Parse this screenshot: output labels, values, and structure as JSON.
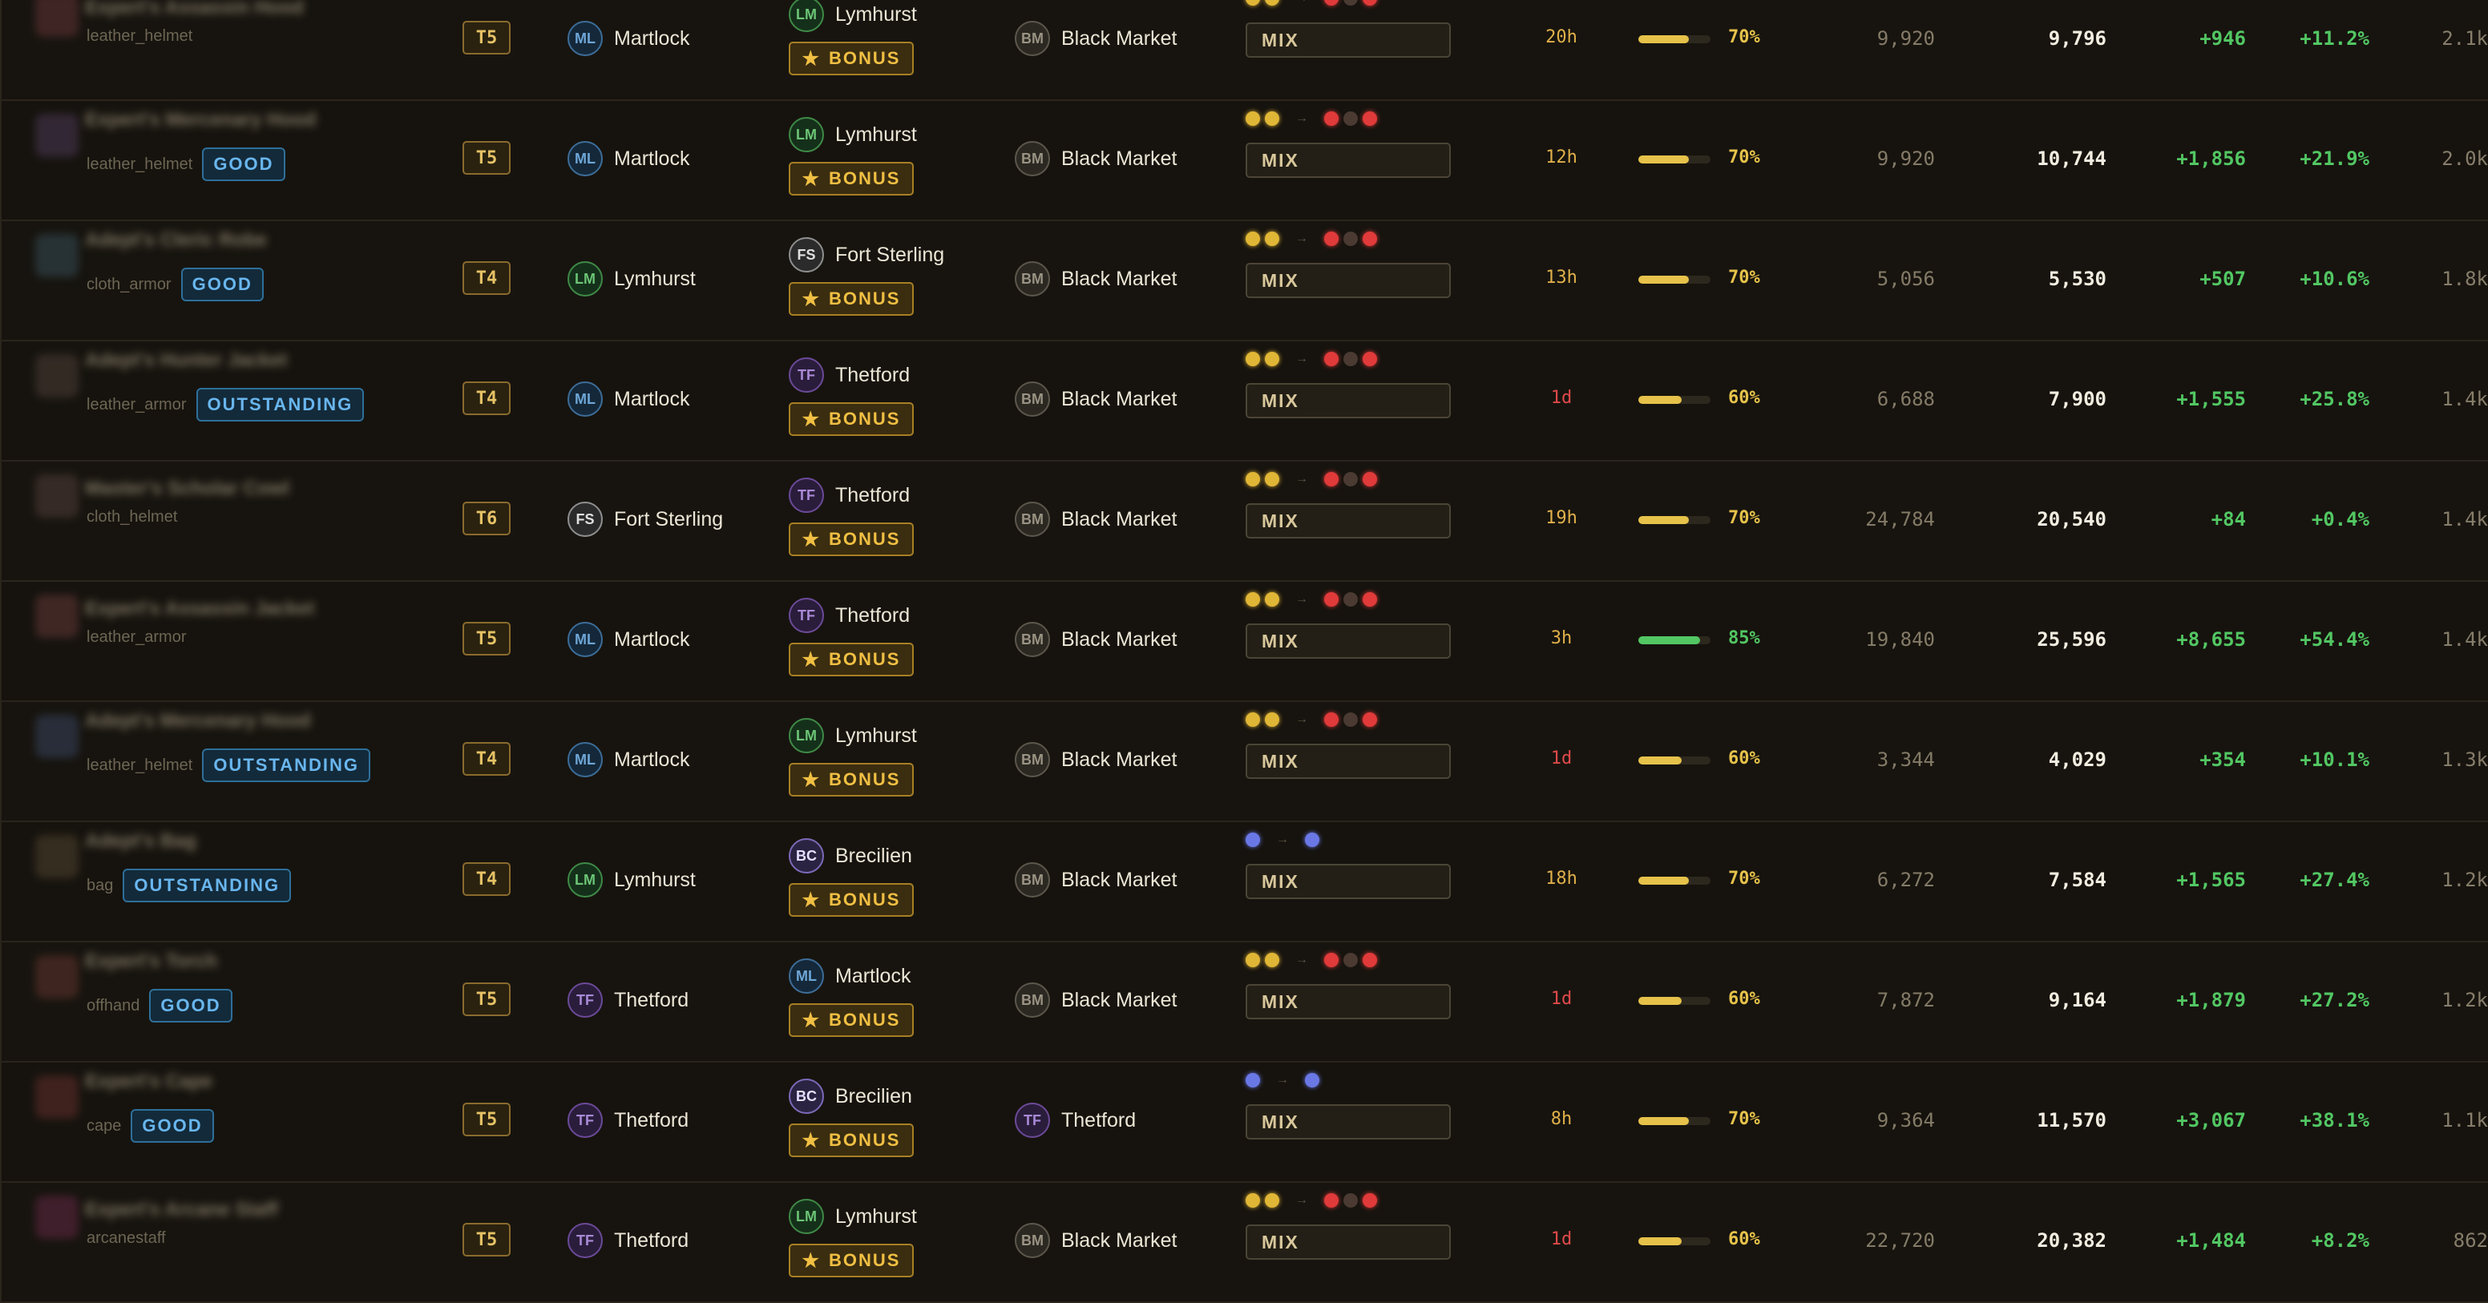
{
  "colors": {
    "ML": {
      "border": "#3d6d98",
      "bg": "#14283a",
      "text": "#6ea6d6"
    },
    "LM": {
      "border": "#3f8a47",
      "bg": "#15301a",
      "text": "#6cc476"
    },
    "FS": {
      "border": "#8f8f8f",
      "bg": "#2b2b2b",
      "text": "#e0e0e0"
    },
    "TF": {
      "border": "#6b4a98",
      "bg": "#2a1d3b",
      "text": "#a98ad6"
    },
    "BC": {
      "border": "#7d69b8",
      "bg": "#2a2442",
      "text": "#e6e0ff"
    },
    "BM": {
      "border": "#5c574c",
      "bg": "#2b2822",
      "text": "#9a9383"
    },
    "age_warn": "#e0b04a",
    "age_bad": "#e04a4a",
    "bar_yellow": "#e6c24a",
    "bar_green": "#52c763"
  },
  "bonus_label": "BONUS",
  "mix_label": "MIX",
  "rows": [
    {
      "item_name": "Expert's Assassin Hood",
      "item_type": "leather_helmet",
      "quality": "",
      "thumb": "#4a2a2a",
      "tier": "T5",
      "buy_code": "ML",
      "buy_city": "Martlock",
      "craft_code": "LM",
      "craft_city": "Lymhurst",
      "sell_code": "BM",
      "sell_city": "Black Market",
      "dots": "yy-rgr",
      "age": "20h",
      "age_level": "warn",
      "bar": 70,
      "pct": "70%",
      "buy": "9,920",
      "sell": "9,796",
      "profit": "+946",
      "margin": "+11.2%",
      "volume": "2.1k"
    },
    {
      "item_name": "Expert's Mercenary Hood",
      "item_type": "leather_helmet",
      "quality": "GOOD",
      "thumb": "#3a2d3e",
      "tier": "T5",
      "buy_code": "ML",
      "buy_city": "Martlock",
      "craft_code": "LM",
      "craft_city": "Lymhurst",
      "sell_code": "BM",
      "sell_city": "Black Market",
      "dots": "yy-rgr",
      "age": "12h",
      "age_level": "warn",
      "bar": 70,
      "pct": "70%",
      "buy": "9,920",
      "sell": "10,744",
      "profit": "+1,856",
      "margin": "+21.9%",
      "volume": "2.0k"
    },
    {
      "item_name": "Adept's Cleric Robe",
      "item_type": "cloth_armor",
      "quality": "GOOD",
      "thumb": "#2c3a3e",
      "tier": "T4",
      "buy_code": "LM",
      "buy_city": "Lymhurst",
      "craft_code": "FS",
      "craft_city": "Fort Sterling",
      "sell_code": "BM",
      "sell_city": "Black Market",
      "dots": "yy-rgr",
      "age": "13h",
      "age_level": "warn",
      "bar": 70,
      "pct": "70%",
      "buy": "5,056",
      "sell": "5,530",
      "profit": "+507",
      "margin": "+10.6%",
      "volume": "1.8k"
    },
    {
      "item_name": "Adept's Hunter Jacket",
      "item_type": "leather_armor",
      "quality": "OUTSTANDING",
      "thumb": "#3b302a",
      "tier": "T4",
      "buy_code": "ML",
      "buy_city": "Martlock",
      "craft_code": "TF",
      "craft_city": "Thetford",
      "sell_code": "BM",
      "sell_city": "Black Market",
      "dots": "yy-rgr",
      "age": "1d",
      "age_level": "bad",
      "bar": 60,
      "pct": "60%",
      "buy": "6,688",
      "sell": "7,900",
      "profit": "+1,555",
      "margin": "+25.8%",
      "volume": "1.4k"
    },
    {
      "item_name": "Master's Scholar Cowl",
      "item_type": "cloth_helmet",
      "quality": "",
      "thumb": "#3e302c",
      "tier": "T6",
      "buy_code": "FS",
      "buy_city": "Fort Sterling",
      "craft_code": "TF",
      "craft_city": "Thetford",
      "sell_code": "BM",
      "sell_city": "Black Market",
      "dots": "yy-rgr",
      "age": "19h",
      "age_level": "warn",
      "bar": 70,
      "pct": "70%",
      "buy": "24,784",
      "sell": "20,540",
      "profit": "+84",
      "margin": "+0.4%",
      "volume": "1.4k"
    },
    {
      "item_name": "Expert's Assassin Jacket",
      "item_type": "leather_armor",
      "quality": "",
      "thumb": "#4a2c2a",
      "tier": "T5",
      "buy_code": "ML",
      "buy_city": "Martlock",
      "craft_code": "TF",
      "craft_city": "Thetford",
      "sell_code": "BM",
      "sell_city": "Black Market",
      "dots": "yy-rgr",
      "age": "3h",
      "age_level": "warn",
      "bar": 85,
      "pct": "85%",
      "buy": "19,840",
      "sell": "25,596",
      "profit": "+8,655",
      "margin": "+54.4%",
      "volume": "1.4k"
    },
    {
      "item_name": "Adept's Mercenary Hood",
      "item_type": "leather_helmet",
      "quality": "OUTSTANDING",
      "thumb": "#2d3444",
      "tier": "T4",
      "buy_code": "ML",
      "buy_city": "Martlock",
      "craft_code": "LM",
      "craft_city": "Lymhurst",
      "sell_code": "BM",
      "sell_city": "Black Market",
      "dots": "yy-rgr",
      "age": "1d",
      "age_level": "bad",
      "bar": 60,
      "pct": "60%",
      "buy": "3,344",
      "sell": "4,029",
      "profit": "+354",
      "margin": "+10.1%",
      "volume": "1.3k"
    },
    {
      "item_name": "Adept's Bag",
      "item_type": "bag",
      "quality": "OUTSTANDING",
      "thumb": "#3d3424",
      "tier": "T4",
      "buy_code": "LM",
      "buy_city": "Lymhurst",
      "craft_code": "BC",
      "craft_city": "Brecilien",
      "sell_code": "BM",
      "sell_city": "Black Market",
      "dots": "b-b",
      "age": "18h",
      "age_level": "warn",
      "bar": 70,
      "pct": "70%",
      "buy": "6,272",
      "sell": "7,584",
      "profit": "+1,565",
      "margin": "+27.4%",
      "volume": "1.2k"
    },
    {
      "item_name": "Expert's Torch",
      "item_type": "offhand",
      "quality": "GOOD",
      "thumb": "#4a2a24",
      "tier": "T5",
      "buy_code": "TF",
      "buy_city": "Thetford",
      "craft_code": "ML",
      "craft_city": "Martlock",
      "sell_code": "BM",
      "sell_city": "Black Market",
      "dots": "yy-rgr",
      "age": "1d",
      "age_level": "bad",
      "bar": 60,
      "pct": "60%",
      "buy": "7,872",
      "sell": "9,164",
      "profit": "+1,879",
      "margin": "+27.2%",
      "volume": "1.2k"
    },
    {
      "item_name": "Expert's Cape",
      "item_type": "cape",
      "quality": "GOOD",
      "thumb": "#4a2622",
      "tier": "T5",
      "buy_code": "TF",
      "buy_city": "Thetford",
      "craft_code": "BC",
      "craft_city": "Brecilien",
      "sell_code": "TF",
      "sell_city": "Thetford",
      "dots": "b-b",
      "age": "8h",
      "age_level": "warn",
      "bar": 70,
      "pct": "70%",
      "buy": "9,364",
      "sell": "11,570",
      "profit": "+3,067",
      "margin": "+38.1%",
      "volume": "1.1k"
    },
    {
      "item_name": "Expert's Arcane Staff",
      "item_type": "arcanestaff",
      "quality": "",
      "thumb": "#4a2232",
      "tier": "T5",
      "buy_code": "TF",
      "buy_city": "Thetford",
      "craft_code": "LM",
      "craft_city": "Lymhurst",
      "sell_code": "BM",
      "sell_city": "Black Market",
      "dots": "yy-rgr",
      "age": "1d",
      "age_level": "bad",
      "bar": 60,
      "pct": "60%",
      "buy": "22,720",
      "sell": "20,382",
      "profit": "+1,484",
      "margin": "+8.2%",
      "volume": "862"
    }
  ]
}
